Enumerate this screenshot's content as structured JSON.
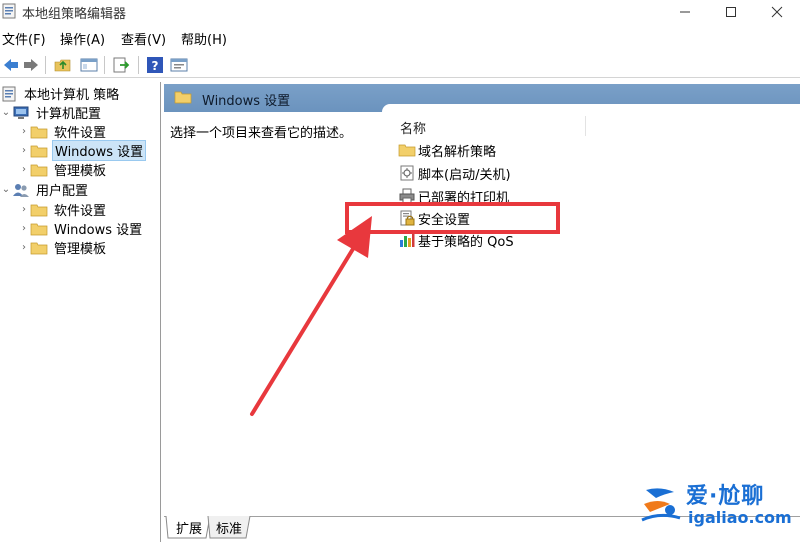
{
  "window": {
    "title": "本地组策略编辑器"
  },
  "menu": {
    "items": [
      "文件(F)",
      "操作(A)",
      "查看(V)",
      "帮助(H)"
    ]
  },
  "toolbar": {
    "buttons": [
      "back-icon",
      "forward-icon",
      "up-folder-icon",
      "show-hide-tree-icon",
      "export-list-icon",
      "help-icon",
      "properties-icon"
    ]
  },
  "tree": {
    "root": "本地计算机 策略",
    "computer_config": "计算机配置",
    "computer_children": [
      "软件设置",
      "Windows 设置",
      "管理模板"
    ],
    "user_config": "用户配置",
    "user_children": [
      "软件设置",
      "Windows 设置",
      "管理模板"
    ]
  },
  "content": {
    "header": "Windows 设置",
    "description": "选择一个项目来查看它的描述。",
    "column_name": "名称",
    "items": [
      "域名解析策略",
      "脚本(启动/关机)",
      "已部署的打印机",
      "安全设置",
      "基于策略的 QoS"
    ]
  },
  "tabs": {
    "expand": "扩展",
    "standard": "标准"
  },
  "watermark": {
    "brand": "爱·尬聊",
    "url": "igaliao.com"
  },
  "colors": {
    "highlight": "#e8383d",
    "selection": "#cce4f7",
    "header_strip": "#7aa0c8",
    "watermark": "#1a6fd4"
  }
}
